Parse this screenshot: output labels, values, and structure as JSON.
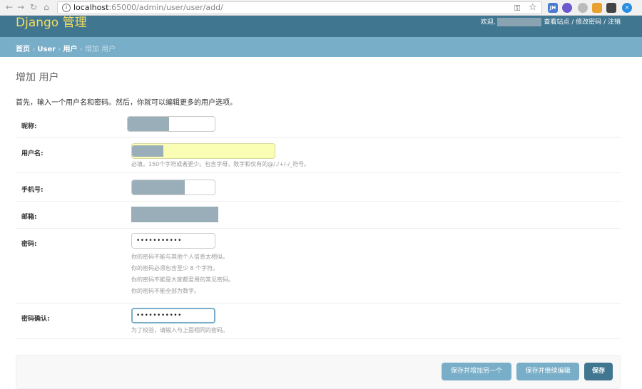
{
  "browser": {
    "url_host": "localhost",
    "url_rest": ":65000/admin/user/user/add/"
  },
  "header": {
    "brand": "Django 管理",
    "welcome": "欢迎,",
    "view_site": "查看站点",
    "change_password": "修改密码",
    "logout": "注销",
    "sep": "/"
  },
  "breadcrumbs": {
    "home": "首页",
    "app": "User",
    "model": "用户",
    "current": "增加 用户",
    "sep": "›"
  },
  "page": {
    "title": "增加 用户",
    "intro": "首先，输入一个用户名和密码。然后，你就可以编辑更多的用户选项。"
  },
  "form": {
    "nickname_label": "昵称:",
    "username_label": "用户名:",
    "username_help": "必填。150个字符或者更少。包含字母，数字和仅有的@/./+/-/_符号。",
    "phone_label": "手机号:",
    "email_label": "邮箱:",
    "password_label": "密码:",
    "password_value": "•••••••••••",
    "password_help_1": "你的密码不能与其他个人信息太相似。",
    "password_help_2": "你的密码必须包含至少 8 个字符。",
    "password_help_3": "你的密码不能是大家都爱用的常见密码。",
    "password_help_4": "你的密码不能全部为数字。",
    "password2_label": "密码确认:",
    "password2_value": "•••••••••••",
    "password2_help": "为了校验，请输入与上面相同的密码。"
  },
  "submit": {
    "save_add_another": "保存并增加另一个",
    "save_continue": "保存并继续编辑",
    "save": "保存"
  },
  "colors": {
    "header": "#417690",
    "breadcrumbs": "#79aec8",
    "brand": "#f5dd5d",
    "autofill": "#fafeb4",
    "focus": "#79aec8"
  }
}
